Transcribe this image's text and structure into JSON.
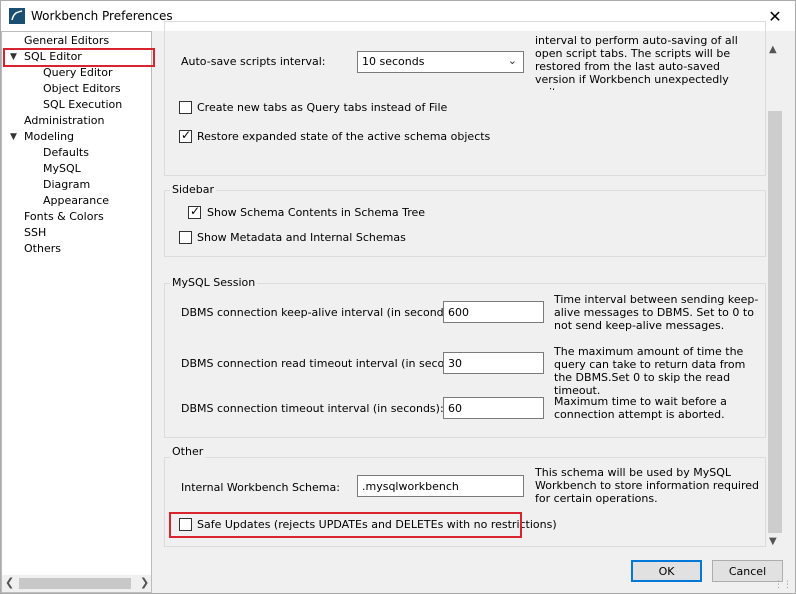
{
  "window": {
    "title": "Workbench Preferences",
    "close_glyph": "✕"
  },
  "tree": {
    "items": [
      {
        "label": "General Editors"
      },
      {
        "label": "SQL Editor",
        "arrow": "▼"
      },
      {
        "label": "Query Editor"
      },
      {
        "label": "Object Editors"
      },
      {
        "label": "SQL Execution"
      },
      {
        "label": "Administration"
      },
      {
        "label": "Modeling",
        "arrow": "▼"
      },
      {
        "label": "Defaults"
      },
      {
        "label": "MySQL"
      },
      {
        "label": "Diagram"
      },
      {
        "label": "Appearance"
      },
      {
        "label": "Fonts & Colors"
      },
      {
        "label": "SSH"
      },
      {
        "label": "Others"
      }
    ]
  },
  "editor": {
    "autosave_label": "Auto-save scripts interval:",
    "autosave_value": "10 seconds",
    "autosave_note": "interval to perform auto-saving of all open script tabs. The scripts will be restored from the last auto-saved version if Workbench unexpectedly quits.",
    "new_tabs_label": "Create new tabs as Query tabs instead of File",
    "restore_label": "Restore expanded state of the active schema objects"
  },
  "sidebar": {
    "title": "Sidebar",
    "show_schema_label": "Show Schema Contents in Schema Tree",
    "show_meta_label": "Show Metadata and Internal Schemas"
  },
  "session": {
    "title": "MySQL Session",
    "keepalive_label": "DBMS connection keep-alive interval (in seconds):",
    "keepalive_value": "600",
    "keepalive_note": "Time interval between sending keep-alive messages to DBMS. Set to 0 to not send keep-alive messages.",
    "read_timeout_label": "DBMS connection read timeout interval (in seconds):",
    "read_timeout_value": "30",
    "read_timeout_note": "The maximum amount of time the query can take to return data from the DBMS.Set 0 to skip the read timeout.",
    "conn_timeout_label": "DBMS connection timeout interval (in seconds):",
    "conn_timeout_value": "60",
    "conn_timeout_note": "Maximum time to wait before a connection attempt is aborted."
  },
  "other": {
    "title": "Other",
    "schema_label": "Internal Workbench Schema:",
    "schema_value": ".mysqlworkbench",
    "schema_note": "This schema will be used by MySQL Workbench to store information required for certain operations.",
    "safe_updates_label": "Safe Updates (rejects UPDATEs and DELETEs with no restrictions)"
  },
  "buttons": {
    "ok": "OK",
    "cancel": "Cancel"
  },
  "colors": {
    "highlight": "#d9232e",
    "accent": "#0078d7"
  }
}
